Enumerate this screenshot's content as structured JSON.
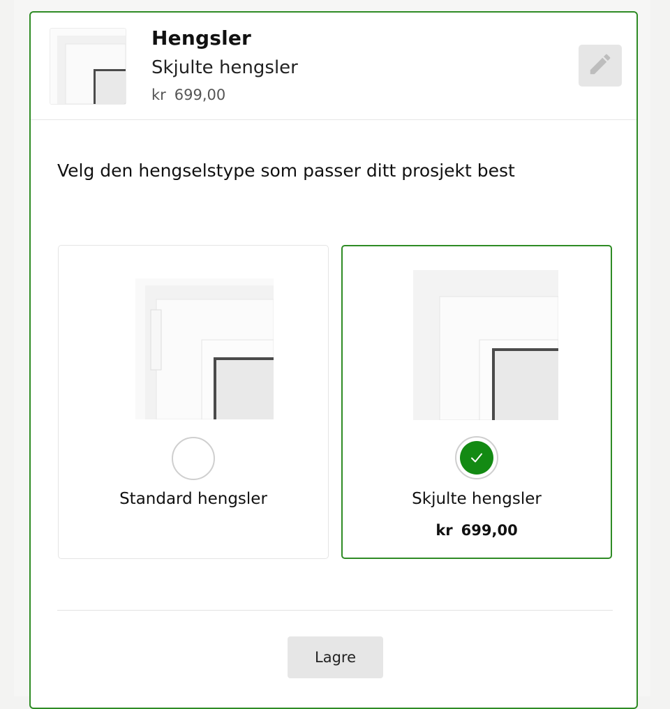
{
  "summary": {
    "title": "Hengsler",
    "selected_option": "Skjulte hengsler",
    "currency": "kr",
    "price": "699,00",
    "edit_icon": "pencil-icon"
  },
  "question": "Velg den hengselstype som passer ditt prosjekt best",
  "options": [
    {
      "label": "Standard hengsler",
      "selected": false,
      "image": "window-corner-standard-hinge"
    },
    {
      "label": "Skjulte hengsler",
      "selected": true,
      "currency": "kr",
      "price": "699,00",
      "image": "window-corner-hidden-hinge"
    }
  ],
  "save_label": "Lagre",
  "colors": {
    "accent": "#138a13",
    "border_selected": "#2e8b24"
  }
}
